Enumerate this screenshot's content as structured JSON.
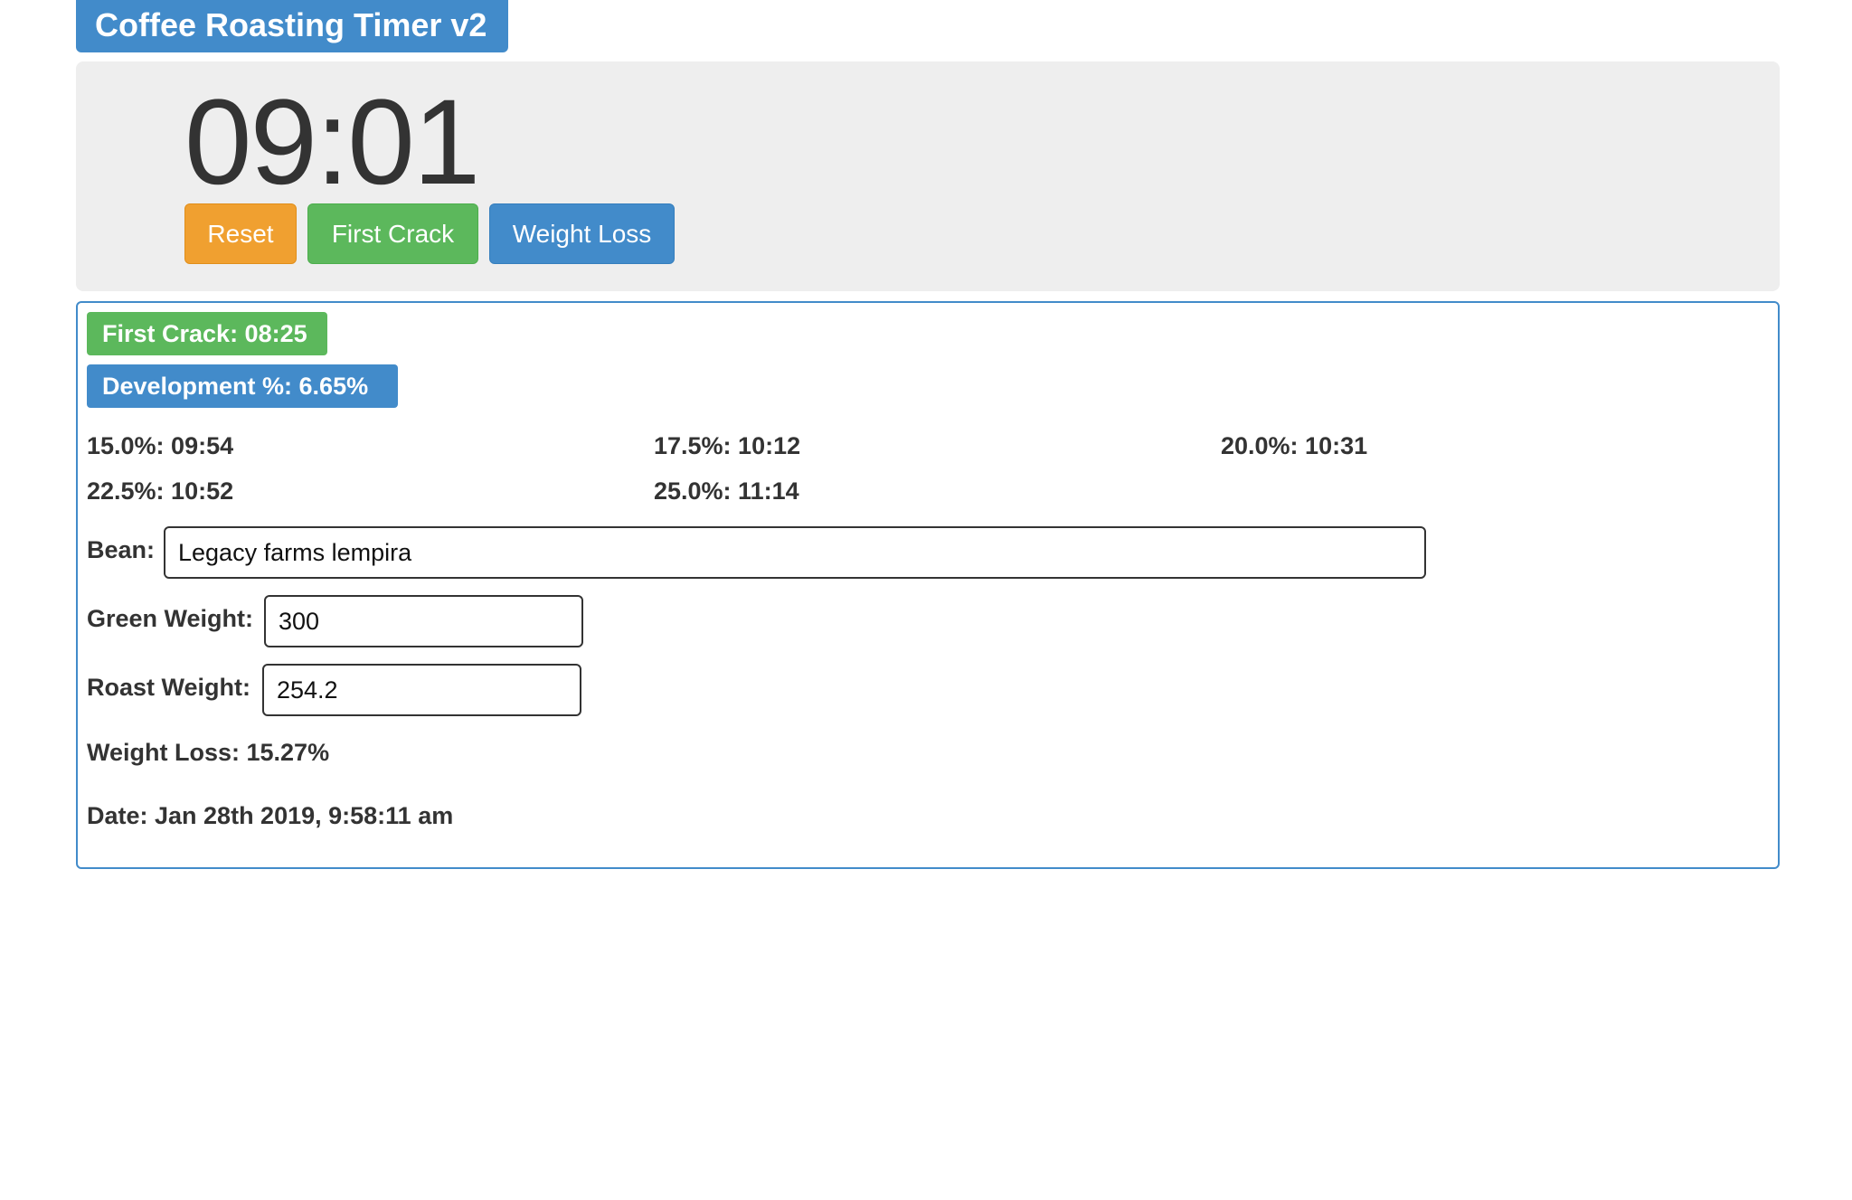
{
  "header": {
    "title": "Coffee Roasting Timer v2"
  },
  "timer": {
    "display": "09:01",
    "buttons": {
      "reset_label": "Reset",
      "first_crack_label": "First Crack",
      "weight_loss_label": "Weight Loss"
    }
  },
  "results": {
    "first_crack": "First Crack: 08:25",
    "development": "Development %: 6.65%",
    "targets": [
      "15.0%: 09:54",
      "17.5%: 10:12",
      "20.0%: 10:31",
      "22.5%: 10:52",
      "25.0%: 11:14"
    ],
    "form": {
      "bean_label": "Bean:",
      "bean_value": "Legacy farms lempira",
      "green_weight_label": "Green Weight:",
      "green_weight_value": "300",
      "roast_weight_label": "Roast Weight:",
      "roast_weight_value": "254.2"
    },
    "weight_loss": "Weight Loss: 15.27%",
    "date": "Date: Jan 28th 2019, 9:58:11 am"
  },
  "colors": {
    "primary": "#428bca",
    "success": "#5cb85c",
    "warning": "#f0a030",
    "jumbotron_bg": "#eeeeee"
  }
}
